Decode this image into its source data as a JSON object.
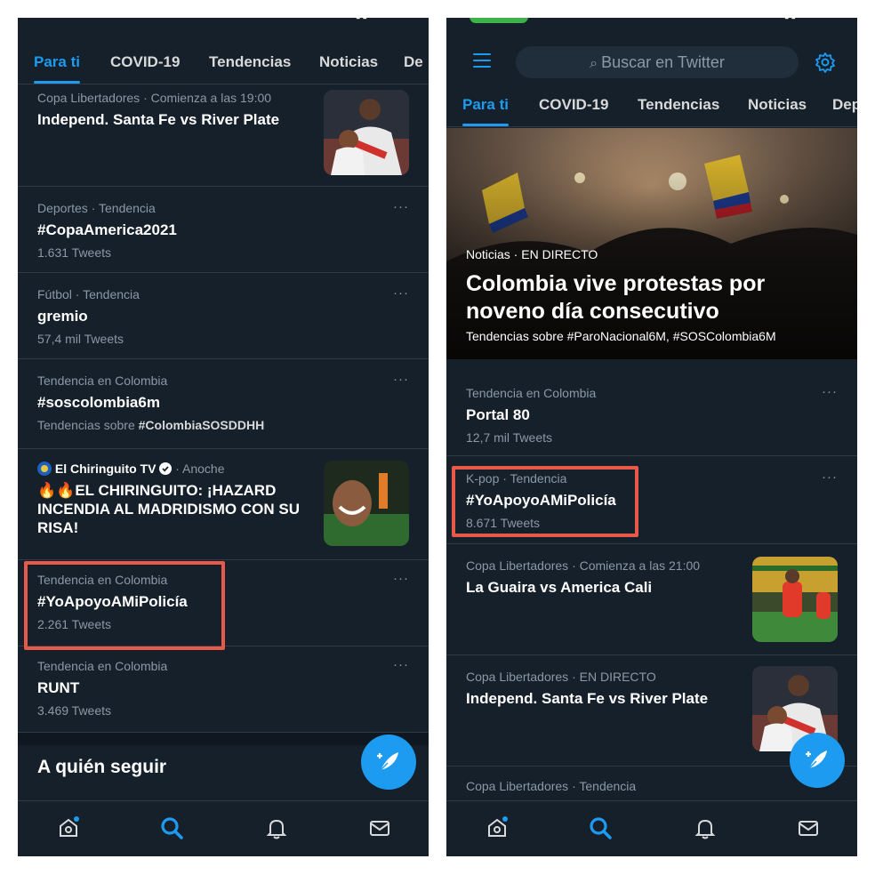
{
  "left": {
    "tabs": [
      "Para ti",
      "COVID-19",
      "Tendencias",
      "Noticias",
      "De"
    ],
    "items": [
      {
        "meta": "Copa Libertadores · Comienza a las 19:00",
        "title": "Independ. Santa Fe vs River Plate"
      },
      {
        "meta": "Deportes · Tendencia",
        "title": "#CopaAmerica2021",
        "count": "1.631 Tweets"
      },
      {
        "meta": "Fútbol · Tendencia",
        "title": "gremio",
        "count": "57,4 mil Tweets"
      },
      {
        "meta": "Tendencia en Colombia",
        "title": "#soscolombia6m",
        "count_prefix": "Tendencias sobre ",
        "count_tag": "#ColombiaSOSDDHH"
      },
      {
        "meta_source": "El Chiringuito TV",
        "meta_time": "· Anoche",
        "title": "🔥🔥EL CHIRINGUITO: ¡HAZARD INCENDIA AL MADRIDISMO CON SU RISA!"
      },
      {
        "meta": "Tendencia en Colombia",
        "title": "#YoApoyoAMiPolicía",
        "count": "2.261 Tweets"
      },
      {
        "meta": "Tendencia en Colombia",
        "title": "RUNT",
        "count": "3.469 Tweets"
      }
    ],
    "section_title": "A quién seguir",
    "more": "···"
  },
  "right": {
    "search_placeholder": "Buscar en Twitter",
    "tabs": [
      "Para ti",
      "COVID-19",
      "Tendencias",
      "Noticias",
      "Dep"
    ],
    "hero": {
      "meta": "Noticias · EN DIRECTO",
      "title": "Colombia vive protestas por noveno día consecutivo",
      "subtitle": "Tendencias sobre #ParoNacional6M, #SOSColombia6M"
    },
    "items": [
      {
        "meta": "Tendencia en Colombia",
        "title": "Portal 80",
        "count": "12,7 mil Tweets"
      },
      {
        "meta": "K-pop · Tendencia",
        "title": "#YoApoyoAMiPolicía",
        "count": "8.671 Tweets"
      },
      {
        "meta": "Copa Libertadores · Comienza a las 21:00",
        "title": "La Guaira vs America Cali"
      },
      {
        "meta": "Copa Libertadores · EN DIRECTO",
        "title": "Independ. Santa Fe vs River Plate"
      },
      {
        "meta": "Copa Libertadores · Tendencia"
      }
    ],
    "more": "···"
  },
  "colors": {
    "background": "#15202b",
    "accent": "#1d9bf0",
    "highlight": "#e8594a",
    "secondary_text": "#8b98a5"
  }
}
